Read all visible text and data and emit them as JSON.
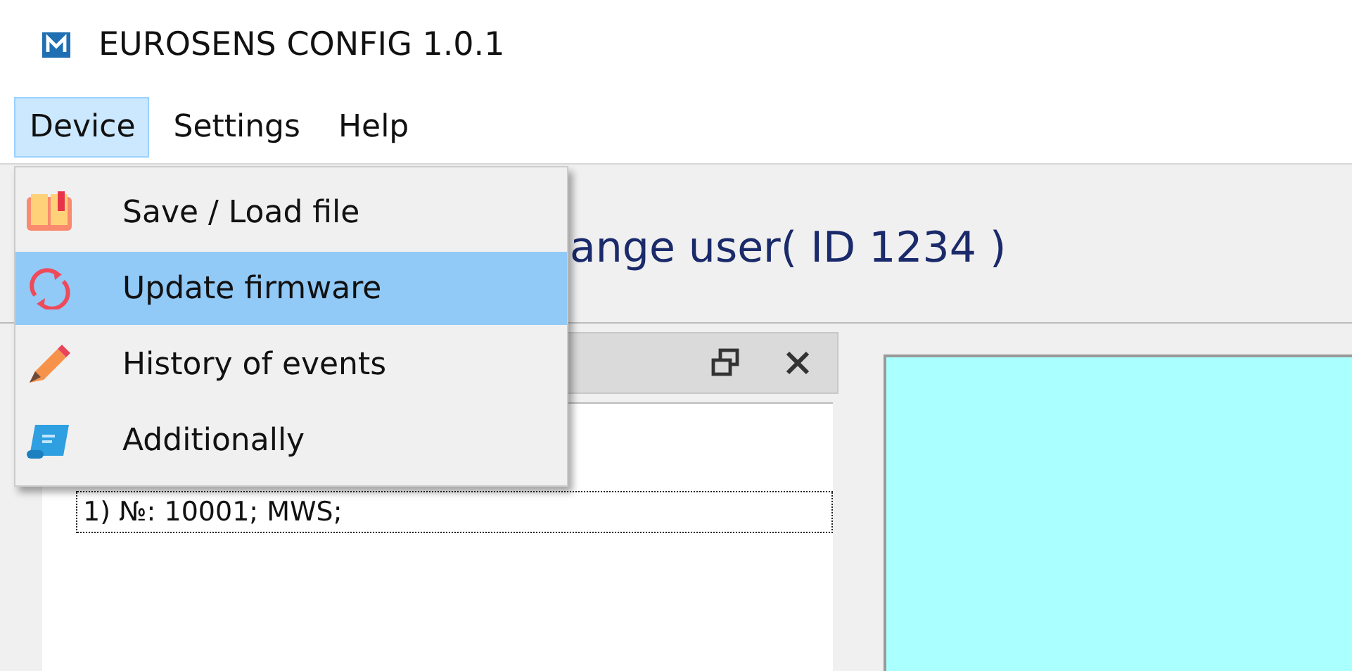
{
  "window": {
    "title": "EUROSENS CONFIG 1.0.1"
  },
  "menubar": [
    {
      "label": "Device",
      "selected": true
    },
    {
      "label": "Settings",
      "selected": false
    },
    {
      "label": "Help",
      "selected": false
    }
  ],
  "dropdown": [
    {
      "label": "Save / Load file",
      "kind": "book",
      "selected": false
    },
    {
      "label": "Update firmware",
      "kind": "refresh",
      "selected": true
    },
    {
      "label": "History of events",
      "kind": "pencil",
      "selected": false
    },
    {
      "label": "Additionally",
      "kind": "scroll",
      "selected": false
    }
  ],
  "heading": "ange user( ID 1234 )",
  "tree": {
    "items": [
      {
        "label": "1) №: 10001; MWS;",
        "focused": true
      }
    ]
  }
}
